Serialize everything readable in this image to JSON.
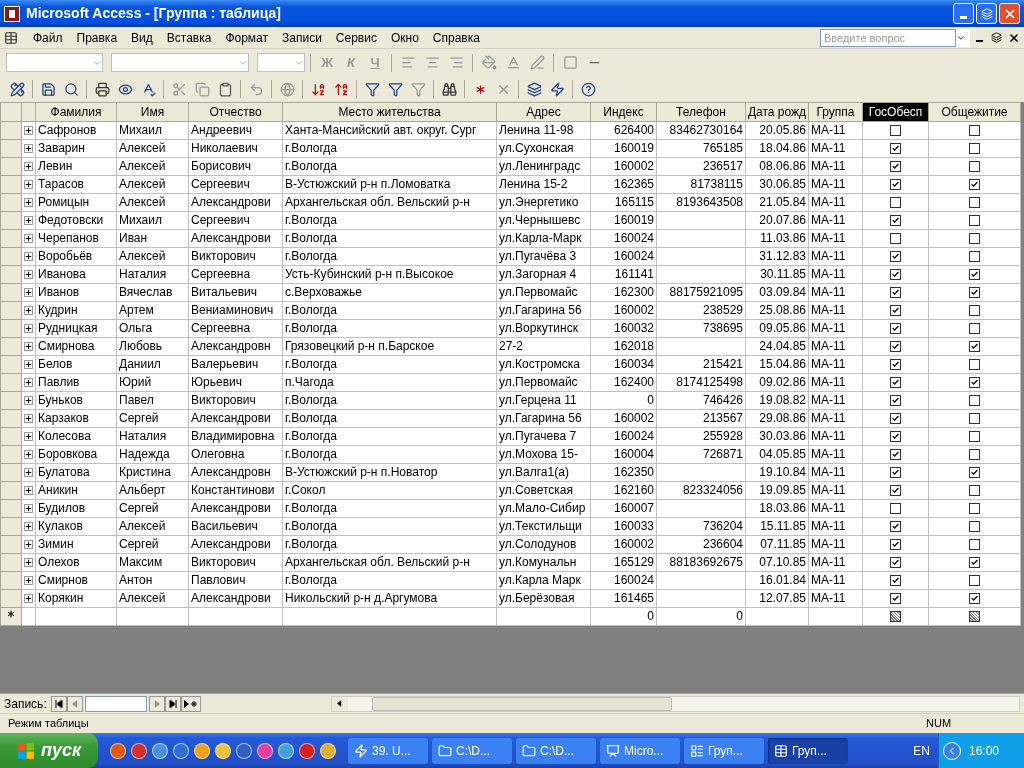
{
  "window": {
    "title": "Microsoft Access - [Группа : таблица]"
  },
  "menu": [
    "Файл",
    "Правка",
    "Вид",
    "Вставка",
    "Формат",
    "Записи",
    "Сервис",
    "Окно",
    "Справка"
  ],
  "question_box": {
    "placeholder": "Введите вопрос"
  },
  "format_buttons": [
    "Ж",
    "К",
    "Ч"
  ],
  "table": {
    "columns": [
      {
        "label": "Фамилия",
        "selected": false
      },
      {
        "label": "Имя",
        "selected": false
      },
      {
        "label": "Отчество",
        "selected": false
      },
      {
        "label": "Место жительства",
        "selected": false
      },
      {
        "label": "Адрес",
        "selected": false
      },
      {
        "label": "Индекс",
        "selected": false
      },
      {
        "label": "Телефон",
        "selected": false
      },
      {
        "label": "Дата рожд",
        "selected": false
      },
      {
        "label": "Группа",
        "selected": false
      },
      {
        "label": "ГосОбесп",
        "selected": true
      },
      {
        "label": "Общежитие",
        "selected": false
      }
    ],
    "rows": [
      {
        "cells": [
          "Сафронов",
          "Михаил",
          "Андреевич",
          "Ханта-Мансийский авт. округ. Сург",
          "Ленина 11-98",
          "626400",
          "83462730164",
          "20.05.86",
          "МА-11"
        ],
        "gos": false,
        "dorm": false
      },
      {
        "cells": [
          "Заварин",
          "Алексей",
          "Николаевич",
          "г.Вологда",
          "ул.Сухонская",
          "160019",
          "765185",
          "18.04.86",
          "МА-11"
        ],
        "gos": true,
        "dorm": false
      },
      {
        "cells": [
          "Левин",
          "Алексей",
          "Борисович",
          "г.Вологда",
          "ул.Ленинградс",
          "160002",
          "236517",
          "08.06.86",
          "МА-11"
        ],
        "gos": true,
        "dorm": false
      },
      {
        "cells": [
          "Тарасов",
          "Алексей",
          "Сергеевич",
          "В-Устюжский р-н п.Ломоватка",
          "Ленина 15-2",
          "162365",
          "81738115",
          "30.06.85",
          "МА-11"
        ],
        "gos": true,
        "dorm": true
      },
      {
        "cells": [
          "Ромицын",
          "Алексей",
          "Александрови",
          "Архангельская обл. Вельский р-н",
          "ул.Энергетико",
          "165115",
          "8193643508",
          "21.05.84",
          "МА-11"
        ],
        "gos": false,
        "dorm": false
      },
      {
        "cells": [
          "Федотовски",
          "Михаил",
          "Сергеевич",
          "г.Вологда",
          "ул.Чернышевс",
          "160019",
          null,
          "20.07.86",
          "МА-11"
        ],
        "gos": true,
        "dorm": false
      },
      {
        "cells": [
          "Черепанов",
          "Иван",
          "Александрови",
          "г.Вологда",
          "ул.Карла-Марк",
          "160024",
          null,
          "11.03.86",
          "МА-11"
        ],
        "gos": false,
        "dorm": false
      },
      {
        "cells": [
          "Воробьёв",
          "Алексей",
          "Викторович",
          "г.Вологда",
          "ул.Пугачёва 3",
          "160024",
          null,
          "31.12.83",
          "МА-11"
        ],
        "gos": true,
        "dorm": false
      },
      {
        "cells": [
          "Иванова",
          "Наталия",
          "Сергеевна",
          "Усть-Кубинский р-н п.Высокое",
          "ул.Загорная 4",
          "161141",
          null,
          "30.11.85",
          "МА-11"
        ],
        "gos": true,
        "dorm": true
      },
      {
        "cells": [
          "Иванов",
          "Вячеслав",
          "Витальевич",
          "с.Верховажье",
          "ул.Первомайс",
          "162300",
          "88175921095",
          "03.09.84",
          "МА-11"
        ],
        "gos": true,
        "dorm": true
      },
      {
        "cells": [
          "Кудрин",
          "Артем",
          "Вениаминович",
          "г.Вологда",
          "ул.Гагарина 56",
          "160002",
          "238529",
          "25.08.86",
          "МА-11"
        ],
        "gos": true,
        "dorm": false
      },
      {
        "cells": [
          "Рудницкая",
          "Ольга",
          "Сергеевна",
          "г.Вологда",
          "ул.Воркутинск",
          "160032",
          "738695",
          "09.05.86",
          "МА-11"
        ],
        "gos": true,
        "dorm": false
      },
      {
        "cells": [
          "Смирнова",
          "Любовь",
          "Александровн",
          "Грязовецкий р-н п.Барское",
          "27-2",
          "162018",
          null,
          "24.04.85",
          "МА-11"
        ],
        "gos": true,
        "dorm": true
      },
      {
        "cells": [
          "Белов",
          "Даниил",
          "Валерьевич",
          "г.Вологда",
          "ул.Костромска",
          "160034",
          "215421",
          "15.04.86",
          "МА-11"
        ],
        "gos": true,
        "dorm": false
      },
      {
        "cells": [
          "Павлив",
          "Юрий",
          "Юрьевич",
          "п.Чагода",
          "ул.Первомайс",
          "162400",
          "8174125498",
          "09.02.86",
          "МА-11"
        ],
        "gos": true,
        "dorm": true
      },
      {
        "cells": [
          "Буньков",
          "Павел",
          "Викторович",
          "г.Вологда",
          "ул.Герцена 11",
          "0",
          "746426",
          "19.08.82",
          "МА-11"
        ],
        "gos": true,
        "dorm": false
      },
      {
        "cells": [
          "Карзаков",
          "Сергей",
          "Александрови",
          "г.Вологда",
          "ул.Гагарина 56",
          "160002",
          "213567",
          "29.08.86",
          "МА-11"
        ],
        "gos": true,
        "dorm": false
      },
      {
        "cells": [
          "Колесова",
          "Наталия",
          "Владимировна",
          "г.Вологда",
          "ул.Пугачева 7",
          "160024",
          "255928",
          "30.03.86",
          "МА-11"
        ],
        "gos": true,
        "dorm": false
      },
      {
        "cells": [
          "Боровкова",
          "Надежда",
          "Олеговна",
          "г.Вологда",
          "ул.Мохова 15-",
          "160004",
          "726871",
          "04.05.85",
          "МА-11"
        ],
        "gos": true,
        "dorm": false
      },
      {
        "cells": [
          "Булатова",
          "Кристина",
          "Александровн",
          "В-Устюжский р-н п.Новатор",
          "ул.Валга1(а)",
          "162350",
          null,
          "19.10.84",
          "МА-11"
        ],
        "gos": true,
        "dorm": true
      },
      {
        "cells": [
          "Аникин",
          "Альберт",
          "Константинови",
          "г.Сокол",
          "ул.Советская",
          "162160",
          "823324056",
          "19.09.85",
          "МА-11"
        ],
        "gos": true,
        "dorm": false
      },
      {
        "cells": [
          "Будилов",
          "Сергей",
          "Александрови",
          "г.Вологда",
          "ул.Мало-Сибир",
          "160007",
          null,
          "18.03.86",
          "МА-11"
        ],
        "gos": false,
        "dorm": false
      },
      {
        "cells": [
          "Кулаков",
          "Алексей",
          "Васильевич",
          "г.Вологда",
          "ул.Текстильщи",
          "160033",
          "736204",
          "15.11.85",
          "МА-11"
        ],
        "gos": true,
        "dorm": false
      },
      {
        "cells": [
          "Зимин",
          "Сергей",
          "Александрови",
          "г.Вологда",
          "ул.Солодунов",
          "160002",
          "236604",
          "07.11.85",
          "МА-11"
        ],
        "gos": true,
        "dorm": false
      },
      {
        "cells": [
          "Олехов",
          "Максим",
          "Викторович",
          "Архангельская обл. Вельский р-н",
          "ул.Комунальн",
          "165129",
          "88183692675",
          "07.10.85",
          "МА-11"
        ],
        "gos": true,
        "dorm": true
      },
      {
        "cells": [
          "Смирнов",
          "Антон",
          "Павлович",
          "г.Вологда",
          "ул.Карла Марк",
          "160024",
          null,
          "16.01.84",
          "МА-11"
        ],
        "gos": true,
        "dorm": false
      },
      {
        "cells": [
          "Корякин",
          "Алексей",
          "Александрови",
          "Никольский р-н д.Аргумова",
          "ул.Берёзовая",
          "161465",
          null,
          "12.07.85",
          "МА-11"
        ],
        "gos": true,
        "dorm": true
      }
    ],
    "new_row": {
      "index": "0",
      "phone": "0",
      "indeterminate": true
    }
  },
  "navigation": {
    "label": "Запись:"
  },
  "status_bar": {
    "mode": "Режим таблицы",
    "num": "NUM"
  },
  "taskbar": {
    "start": "пуск",
    "tasks": [
      {
        "label": "39. U...",
        "kind": "app",
        "selected": false
      },
      {
        "label": "C:\\D...",
        "kind": "folder",
        "selected": false
      },
      {
        "label": "C:\\D...",
        "kind": "folder",
        "selected": false
      },
      {
        "label": "Micro...",
        "kind": "ppt",
        "selected": false
      },
      {
        "label": "Груп...",
        "kind": "form",
        "selected": false
      },
      {
        "label": "Груп...",
        "kind": "table",
        "selected": true
      }
    ],
    "language": "EN",
    "clock": "16:00"
  }
}
